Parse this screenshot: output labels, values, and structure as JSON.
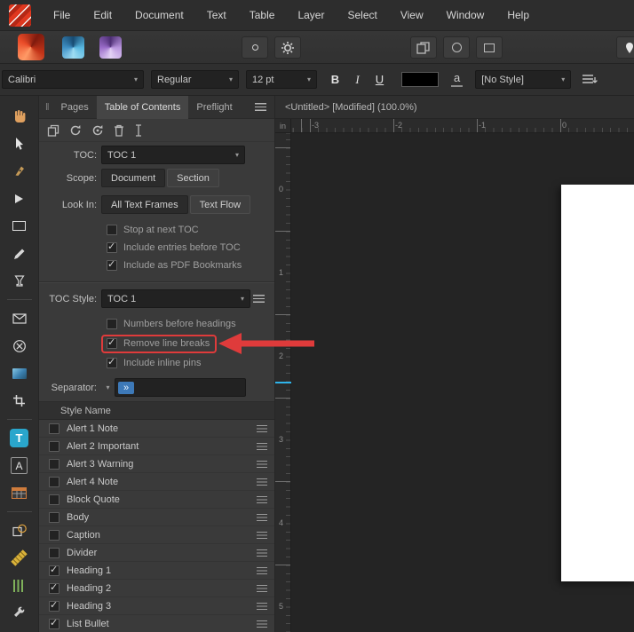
{
  "colors": {
    "accent_teal": "#2aa6cc",
    "annotation_red": "#df3b3b",
    "app_red": "#e0381f",
    "cursor_blue": "#2fb4ea"
  },
  "menubar": {
    "items": [
      "File",
      "Edit",
      "Document",
      "Text",
      "Table",
      "Layer",
      "Select",
      "View",
      "Window",
      "Help"
    ]
  },
  "toolbar": {
    "icons": [
      "publisher-app-icon",
      "designer-app-icon",
      "photo-app-icon",
      "dot-options-button",
      "settings-gear-button",
      "pages-button",
      "ellipse-button",
      "frame-button",
      "pin-button"
    ]
  },
  "text_toolbar": {
    "font_name": "Calibri",
    "font_weight": "Regular",
    "font_size": "12 pt",
    "bold_label": "B",
    "italic_label": "I",
    "underline_label": "U",
    "char_glyph": "a",
    "paragraph_style": "[No Style]"
  },
  "left_toolbar": {
    "selected_tool": "frame-text-tool",
    "tools": [
      "view-hand-tool",
      "move-tool",
      "pen-tool",
      "insert-tool",
      "frame-tool",
      "pencil-tool",
      "fill-tool",
      "envelope-tool",
      "transparency-tool",
      "picture-frame-tool",
      "vector-crop-tool",
      "frame-text-tool",
      "artistic-text-tool",
      "table-tool",
      "shape-tool",
      "ruler-tool",
      "fields-tool",
      "utilities-tool"
    ]
  },
  "panel": {
    "tabs": [
      {
        "label": "Pages",
        "active": false
      },
      {
        "label": "Table of Contents",
        "active": true
      },
      {
        "label": "Preflight",
        "active": false
      }
    ],
    "toc": {
      "label": "TOC:",
      "value": "TOC 1"
    },
    "scope": {
      "label": "Scope:",
      "options": [
        {
          "label": "Document",
          "selected": true
        },
        {
          "label": "Section",
          "selected": false
        }
      ]
    },
    "look_in": {
      "label": "Look In:",
      "options": [
        {
          "label": "All Text Frames",
          "selected": true
        },
        {
          "label": "Text Flow",
          "selected": false
        }
      ]
    },
    "options": [
      {
        "label": "Stop at next TOC",
        "checked": false
      },
      {
        "label": "Include entries before TOC",
        "checked": true
      },
      {
        "label": "Include as PDF Bookmarks",
        "checked": true
      }
    ],
    "toc_style": {
      "label": "TOC Style:",
      "value": "TOC 1"
    },
    "style_options": [
      {
        "label": "Numbers before headings",
        "checked": false,
        "highlighted": false
      },
      {
        "label": "Remove line breaks",
        "checked": true,
        "highlighted": true
      },
      {
        "label": "Include inline pins",
        "checked": true,
        "highlighted": false
      }
    ],
    "separator": {
      "label": "Separator:",
      "chip": "»"
    },
    "styles": {
      "header": "Style Name",
      "rows": [
        {
          "name": "Alert 1 Note",
          "checked": false
        },
        {
          "name": "Alert 2 Important",
          "checked": false
        },
        {
          "name": "Alert 3 Warning",
          "checked": false
        },
        {
          "name": "Alert 4 Note",
          "checked": false
        },
        {
          "name": "Block Quote",
          "checked": false
        },
        {
          "name": "Body",
          "checked": false
        },
        {
          "name": "Caption",
          "checked": false
        },
        {
          "name": "Divider",
          "checked": false
        },
        {
          "name": "Heading 1",
          "checked": true
        },
        {
          "name": "Heading 2",
          "checked": true
        },
        {
          "name": "Heading 3",
          "checked": true
        },
        {
          "name": "List Bullet",
          "checked": true
        }
      ]
    }
  },
  "canvas": {
    "document_title": "<Untitled> [Modified] (100.0%)",
    "ruler_unit": "in",
    "h_ruler_ticks": [
      "-3",
      "-2",
      "-1",
      "0"
    ],
    "v_ruler_ticks": [
      "0",
      "1",
      "2",
      "3",
      "4",
      "5"
    ]
  },
  "annotation": {
    "type": "box-and-arrow",
    "target": "Remove line breaks"
  }
}
